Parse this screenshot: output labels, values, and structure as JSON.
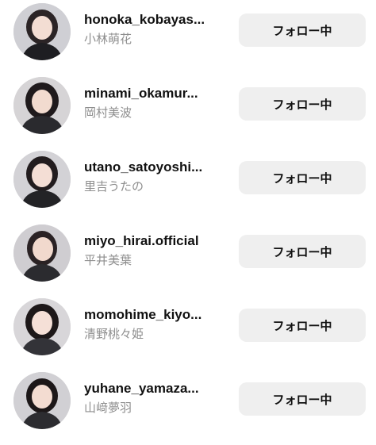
{
  "following_list": [
    {
      "username": "honoka_kobayas...",
      "name": "小林萌花",
      "button": "フォロー中",
      "bg": "#cfcfd4",
      "hair": "#2b2426",
      "outfit": "#1e1e22"
    },
    {
      "username": "minami_okamur...",
      "name": "岡村美波",
      "button": "フォロー中",
      "bg": "#d6d4d6",
      "hair": "#1f1a1c",
      "outfit": "#2a2a2e"
    },
    {
      "username": "utano_satoyoshi...",
      "name": "里吉うたの",
      "button": "フォロー中",
      "bg": "#d3d2d6",
      "hair": "#221c1e",
      "outfit": "#232326"
    },
    {
      "username": "miyo_hirai.official",
      "name": "平井美葉",
      "button": "フォロー中",
      "bg": "#cfcdd1",
      "hair": "#2a2224",
      "outfit": "#2b2b2f"
    },
    {
      "username": "momohime_kiyo...",
      "name": "清野桃々姫",
      "button": "フォロー中",
      "bg": "#d8d6d9",
      "hair": "#1d1819",
      "outfit": "#333338"
    },
    {
      "username": "yuhane_yamaza...",
      "name": "山﨑夢羽",
      "button": "フォロー中",
      "bg": "#d1d0d4",
      "hair": "#1c1718",
      "outfit": "#2c2c30"
    }
  ]
}
